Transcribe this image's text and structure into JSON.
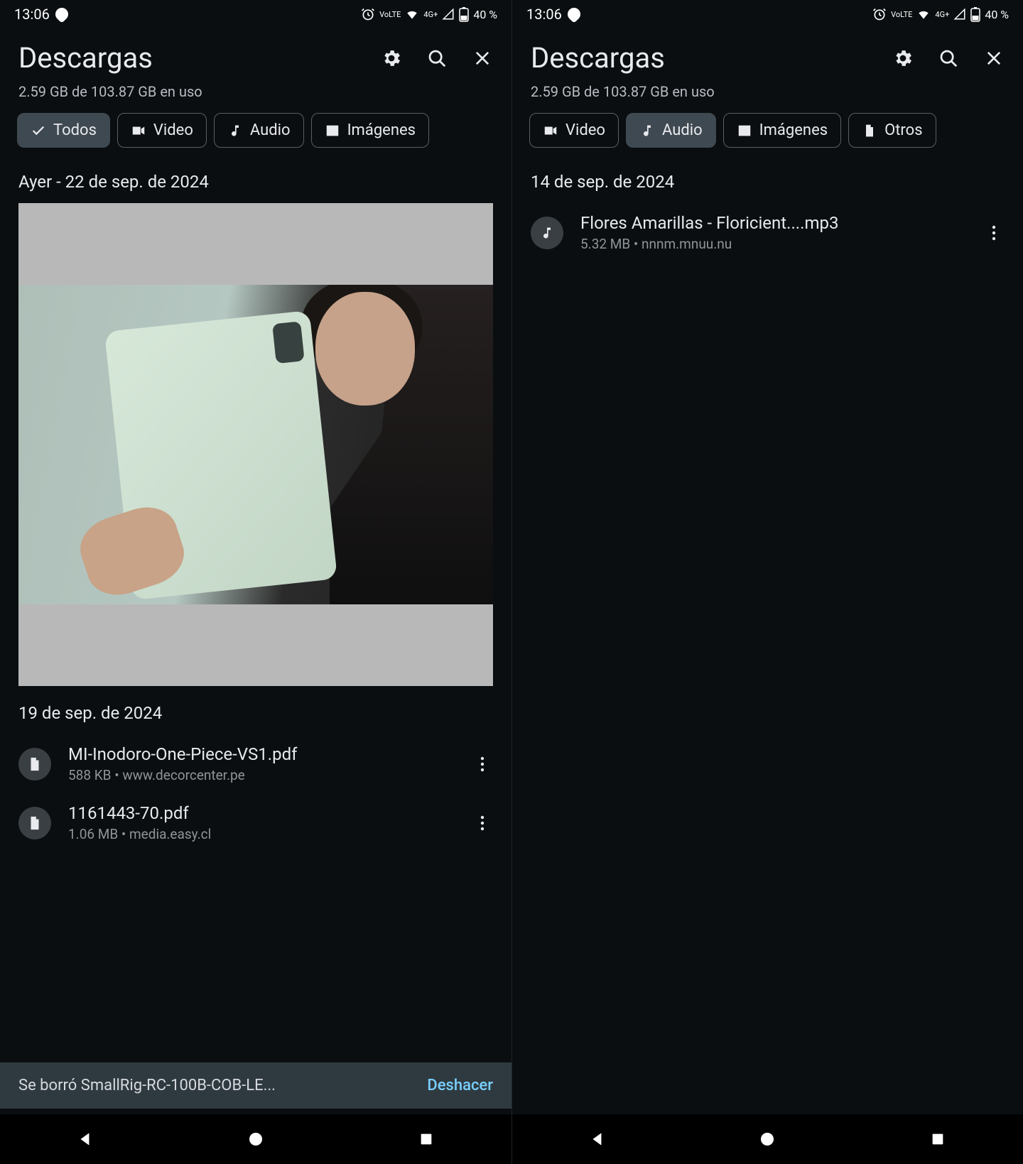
{
  "status": {
    "time": "13:06",
    "alarm_icon": "alarm-icon",
    "lte": "VoLTE",
    "net": "4G+",
    "battery": "40 %"
  },
  "left": {
    "title": "Descargas",
    "storage": "2.59 GB de 103.87 GB en uso",
    "chips": {
      "todos": "Todos",
      "video": "Video",
      "audio": "Audio",
      "imagenes": "Imágenes"
    },
    "section1": "Ayer - 22 de sep. de 2024",
    "section2": "19 de sep. de 2024",
    "files": [
      {
        "name": "MI-Inodoro-One-Piece-VS1.pdf",
        "sub": "588 KB • www.decorcenter.pe"
      },
      {
        "name": "1161443-70.pdf",
        "sub": "1.06 MB • media.easy.cl"
      }
    ],
    "snackbar_msg": "Se borró SmallRig-RC-100B-COB-LE...",
    "snackbar_action": "Deshacer"
  },
  "right": {
    "title": "Descargas",
    "storage": "2.59 GB de 103.87 GB en uso",
    "chips": {
      "video": "Video",
      "audio": "Audio",
      "imagenes": "Imágenes",
      "otros": "Otros"
    },
    "section1": "14 de sep. de 2024",
    "files": [
      {
        "name": "Flores Amarillas - Floricient....mp3",
        "sub": "5.32 MB • nnnm.mnuu.nu"
      }
    ]
  }
}
